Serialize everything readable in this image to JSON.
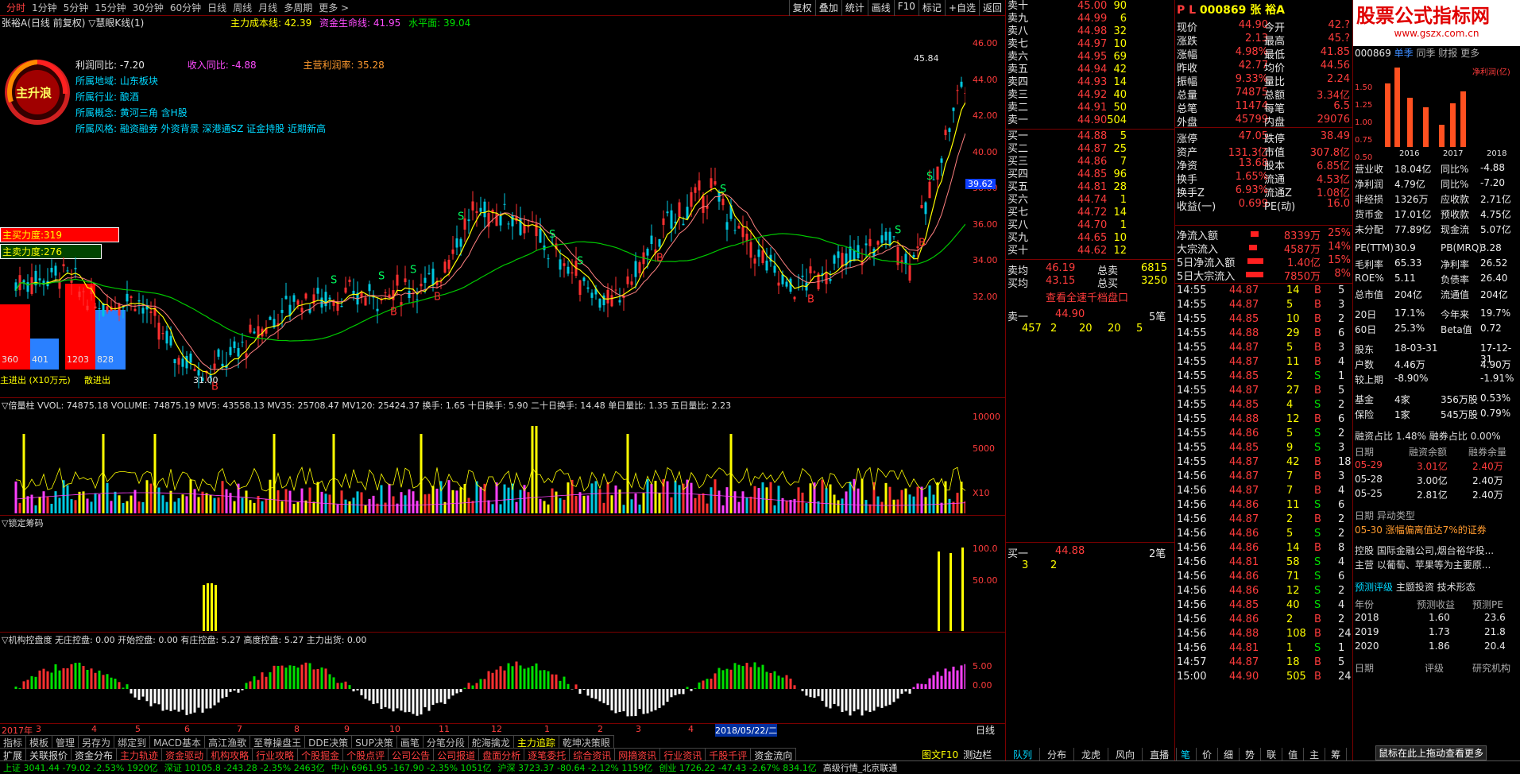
{
  "topbar": {
    "tabs": [
      "分时",
      "1分钟",
      "5分钟",
      "15分钟",
      "30分钟",
      "60分钟",
      "日线",
      "周线",
      "月线",
      "多周期",
      "更多 >"
    ],
    "buttons": [
      "复权",
      "叠加",
      "统计",
      "画线",
      "F10",
      "标记",
      "+自选",
      "返回"
    ]
  },
  "chart_title": "张裕A(日线 前复权) ▽慧眼K线(1)",
  "legend1": {
    "a": "主力成本线: 42.39",
    "b": "资金生命线: 41.95",
    "c": "水平面: 39.04"
  },
  "info": {
    "profit_yoy": "利润同比: -7.20",
    "rev_yoy": "收入同比: -4.88",
    "main_profit": "主营利润率: 35.28",
    "region": "所属地域: 山东板块",
    "industry": "所属行业: 酿酒",
    "concept": "所属概念: 黄河三角 含H股",
    "style": "所属风格: 融资融券 外资背景 深港通SZ 证金持股 近期新高"
  },
  "gauge_label": "主升浪",
  "buy_pow": "主买力度:319",
  "sell_pow": "主卖力度:276",
  "flow": {
    "v1": "360",
    "v2": "401",
    "v3": "1203",
    "v4": "828",
    "in": "主进出 (X10万元)",
    "out": "散进出"
  },
  "price_axis": [
    "46.00",
    "44.00",
    "42.00",
    "40.00",
    "38.00",
    "36.00",
    "34.00",
    "32.00"
  ],
  "price_tag": "39.62",
  "hi_label": "45.84",
  "lo_label": "31.00",
  "vol_legend": "▽倍量柱 VVOL: 74875.18  VOLUME: 74875.19  MV5: 43558.13  MV35: 25708.47  MV120: 25424.37  换手: 1.65  十日换手: 5.90  二十日换手: 14.48  单日量比: 1.35  五日量比: 2.23",
  "vol_axis": [
    "10000",
    "5000",
    "X10"
  ],
  "lock_legend": "▽锁定筹码",
  "lock_axis": [
    "100.0",
    "50.00"
  ],
  "inst_legend": "▽机构控盘度  无庄控盘: 0.00  开始控盘: 0.00  有庄控盘: 5.27  高度控盘: 5.27  主力出货: 0.00",
  "inst_axis": [
    "5.00",
    "0.00"
  ],
  "dates": [
    "2017年",
    "3",
    "4",
    "5",
    "6",
    "7",
    "8",
    "9",
    "10",
    "11",
    "12",
    "1",
    "2",
    "3",
    "4",
    "2018/05/22/二"
  ],
  "bottom_tabs1": [
    "指标",
    "模板",
    "管理",
    "另存为",
    "绑定到",
    "MACD基本",
    "高江渔歌",
    "至尊操盘王",
    "DDE决策",
    "SUP决策",
    "画笔",
    "分笔分段",
    "舵海擒龙",
    "主力追踪",
    "乾坤决策眼"
  ],
  "bottom_tabs2": [
    "扩展",
    "关联报价",
    "资金分布",
    "主力轨迹",
    "资金驱动",
    "机构攻略",
    "行业攻略",
    "个股掘金",
    "个股点评",
    "公司公告",
    "公司报道",
    "盘面分析",
    "逐笔委托",
    "综合资讯",
    "网摘资讯",
    "行业资讯",
    "千股千评",
    "资金流向"
  ],
  "day_btn": "日线",
  "fig_btn": "图文F10",
  "auto_btn": "测边栏",
  "sell_orders": [
    [
      "卖十",
      "45.00",
      "90"
    ],
    [
      "卖九",
      "44.99",
      "6"
    ],
    [
      "卖八",
      "44.98",
      "32"
    ],
    [
      "卖七",
      "44.97",
      "10"
    ],
    [
      "卖六",
      "44.95",
      "69"
    ],
    [
      "卖五",
      "44.94",
      "42"
    ],
    [
      "卖四",
      "44.93",
      "14"
    ],
    [
      "卖三",
      "44.92",
      "40"
    ],
    [
      "卖二",
      "44.91",
      "50"
    ],
    [
      "卖一",
      "44.90",
      "504"
    ]
  ],
  "buy_orders": [
    [
      "买一",
      "44.88",
      "5"
    ],
    [
      "买二",
      "44.87",
      "25"
    ],
    [
      "买三",
      "44.86",
      "7"
    ],
    [
      "买四",
      "44.85",
      "96"
    ],
    [
      "买五",
      "44.81",
      "28"
    ],
    [
      "买六",
      "44.74",
      "1"
    ],
    [
      "买七",
      "44.72",
      "14"
    ],
    [
      "买八",
      "44.70",
      "1"
    ],
    [
      "买九",
      "44.65",
      "10"
    ],
    [
      "买十",
      "44.62",
      "12"
    ]
  ],
  "avg": [
    [
      "卖均",
      "46.19",
      "总卖",
      "6815"
    ],
    [
      "买均",
      "43.15",
      "总买",
      "3250"
    ]
  ],
  "view_all": "查看全速千档盘口",
  "sell1_queue": {
    "label": "卖一",
    "price": "44.90",
    "count": "5笔",
    "items": [
      "457",
      "2",
      "20",
      "20",
      "5"
    ]
  },
  "buy1_queue": {
    "label": "买一",
    "price": "44.88",
    "count": "2笔",
    "items": [
      "3",
      "2"
    ]
  },
  "mid_tabs": [
    "队列",
    "分布",
    "龙虎",
    "风向",
    "直播"
  ],
  "quote_header": {
    "pl": "P L",
    "code": "000869",
    "name": "张 裕A"
  },
  "quote": [
    [
      "现价",
      "44.90",
      "今开",
      "42.?"
    ],
    [
      "涨跌",
      "2.13",
      "最高",
      "45.?"
    ],
    [
      "涨幅",
      "4.98%",
      "最低",
      "41.85"
    ],
    [
      "昨收",
      "42.77",
      "均价",
      "44.56"
    ],
    [
      "振幅",
      "9.33%",
      "量比",
      "2.24"
    ],
    [
      "总量",
      "74875",
      "总额",
      "3.34亿"
    ],
    [
      "总笔",
      "11474",
      "每笔",
      "6.5"
    ],
    [
      "外盘",
      "45799",
      "内盘",
      "29076"
    ],
    [
      "涨停",
      "47.05",
      "跌停",
      "38.49"
    ],
    [
      "资产",
      "131.3亿",
      "市值",
      "307.8亿"
    ],
    [
      "净资",
      "13.68",
      "股本",
      "6.85亿"
    ],
    [
      "换手",
      "1.65%",
      "流通",
      "4.53亿"
    ],
    [
      "换手Z",
      "6.93%",
      "流通Z",
      "1.08亿"
    ],
    [
      "收益(一)",
      "0.699",
      "PE(动)",
      "16.0"
    ]
  ],
  "flows": [
    [
      "净流入额",
      "8339万",
      "25%"
    ],
    [
      "大宗流入",
      "4587万",
      "14%"
    ],
    [
      "5日净流入额",
      "1.40亿",
      "15%"
    ],
    [
      "5日大宗流入",
      "7850万",
      "8%"
    ]
  ],
  "ticks": [
    [
      "14:55",
      "44.87",
      "14",
      "B",
      "5"
    ],
    [
      "14:55",
      "44.87",
      "5",
      "B",
      "3"
    ],
    [
      "14:55",
      "44.85",
      "10",
      "B",
      "2"
    ],
    [
      "14:55",
      "44.88",
      "29",
      "B",
      "6"
    ],
    [
      "14:55",
      "44.87",
      "5",
      "B",
      "3"
    ],
    [
      "14:55",
      "44.87",
      "11",
      "B",
      "4"
    ],
    [
      "14:55",
      "44.85",
      "2",
      "S",
      "1"
    ],
    [
      "14:55",
      "44.87",
      "27",
      "B",
      "5"
    ],
    [
      "14:55",
      "44.85",
      "4",
      "S",
      "2"
    ],
    [
      "14:55",
      "44.88",
      "12",
      "B",
      "6"
    ],
    [
      "14:55",
      "44.86",
      "5",
      "S",
      "2"
    ],
    [
      "14:55",
      "44.85",
      "9",
      "S",
      "3"
    ],
    [
      "14:55",
      "44.87",
      "42",
      "B",
      "18"
    ],
    [
      "14:56",
      "44.87",
      "7",
      "B",
      "3"
    ],
    [
      "14:56",
      "44.87",
      "7",
      "B",
      "4"
    ],
    [
      "14:56",
      "44.86",
      "11",
      "S",
      "6"
    ],
    [
      "14:56",
      "44.87",
      "2",
      "B",
      "2"
    ],
    [
      "14:56",
      "44.86",
      "5",
      "S",
      "2"
    ],
    [
      "14:56",
      "44.86",
      "14",
      "B",
      "8"
    ],
    [
      "14:56",
      "44.81",
      "58",
      "S",
      "4"
    ],
    [
      "14:56",
      "44.86",
      "71",
      "S",
      "6"
    ],
    [
      "14:56",
      "44.86",
      "12",
      "S",
      "2"
    ],
    [
      "14:56",
      "44.85",
      "40",
      "S",
      "4"
    ],
    [
      "14:56",
      "44.86",
      "2",
      "B",
      "2"
    ],
    [
      "14:56",
      "44.88",
      "108",
      "B",
      "24"
    ],
    [
      "14:56",
      "44.81",
      "1",
      "S",
      "1"
    ],
    [
      "14:57",
      "44.87",
      "18",
      "B",
      "5"
    ],
    [
      "15:00",
      "44.90",
      "505",
      "B",
      "24"
    ]
  ],
  "right_tabs": [
    "笔",
    "价",
    "细",
    "势",
    "联",
    "值",
    "主",
    "筹"
  ],
  "f10": {
    "banner": "股票公式指标网",
    "site": "www.gszx.com.cn",
    "code": "000869",
    "tabs": [
      "单季",
      "同季",
      "财报",
      "更多"
    ],
    "chart_label": "净利润(亿)",
    "years": [
      "2016",
      "2017",
      "2018"
    ],
    "rows": [
      [
        "营业收",
        "18.04亿",
        "同比%",
        "-4.88"
      ],
      [
        "净利润",
        "4.79亿",
        "同比%",
        "-7.20"
      ],
      [
        "非经损",
        "1326万",
        "应收款",
        "2.71亿"
      ],
      [
        "货币金",
        "17.01亿",
        "预收款",
        "4.75亿"
      ],
      [
        "未分配",
        "77.89亿",
        "现金流",
        "5.07亿"
      ],
      [
        "PE(TTM)",
        "30.9",
        "PB(MRQ)",
        "3.28"
      ],
      [
        "毛利率",
        "65.33",
        "净利率",
        "26.52"
      ],
      [
        "ROE%",
        "5.11",
        "负债率",
        "26.40"
      ],
      [
        "总市值",
        "204亿",
        "流通值",
        "204亿"
      ],
      [
        "20日",
        "17.1%",
        "今年来",
        "19.7%"
      ],
      [
        "60日",
        "25.3%",
        "Beta值",
        "0.72"
      ],
      [
        "股东",
        "18-03-31",
        "",
        "17-12-31"
      ],
      [
        "户数",
        "4.46万",
        "",
        "4.90万"
      ],
      [
        "较上期",
        "-8.90%",
        "",
        "-1.91%"
      ],
      [
        "基金",
        "4家",
        "356万股",
        "0.53%"
      ],
      [
        "保险",
        "1家",
        "545万股",
        "0.79%"
      ]
    ],
    "margin_title": [
      "融资占比",
      "1.48%",
      "融券占比",
      "0.00%"
    ],
    "margin_head": [
      "日期",
      "融资余额",
      "融券余量"
    ],
    "margin": [
      [
        "05-29",
        "3.01亿",
        "2.40万"
      ],
      [
        "05-28",
        "3.00亿",
        "2.40万"
      ],
      [
        "05-25",
        "2.81亿",
        "2.40万"
      ]
    ],
    "event_head": [
      "日期",
      "异动类型"
    ],
    "event": [
      "05-30",
      "涨幅偏离值达7%的证券"
    ],
    "ctrl": [
      "控股",
      "国际金融公司,烟台裕华投..."
    ],
    "main_biz": [
      "主营",
      "以葡萄、苹果等为主要原..."
    ],
    "pred_tabs": [
      "预测评级",
      "主题投资",
      "技术形态"
    ],
    "pred_head": [
      "年份",
      "预测收益",
      "预测PE"
    ],
    "pred": [
      [
        "2018",
        "1.60",
        "23.6"
      ],
      [
        "2019",
        "1.73",
        "21.8"
      ],
      [
        "2020",
        "1.86",
        "20.4"
      ]
    ],
    "rating_head": [
      "日期",
      "评级",
      "研究机构"
    ],
    "tooltip": "鼠标在此上拖动查看更多"
  },
  "bottombar": [
    "上证 3041.44 -79.02 -2.53% 1920亿",
    "深证 10105.8 -243.28 -2.35% 2463亿",
    "中小 6961.95 -167.90 -2.35% 1051亿",
    "沪深 3723.37 -80.64 -2.12% 1159亿",
    "创业 1726.22 -47.43 -2.67% 834.1亿",
    "高级行情_北京联通"
  ]
}
